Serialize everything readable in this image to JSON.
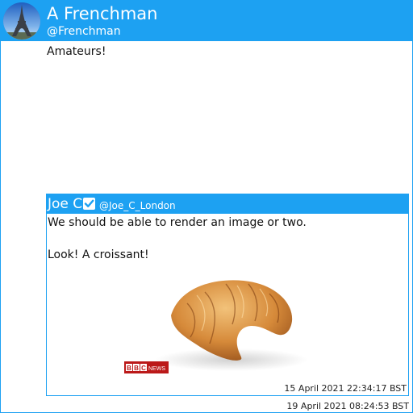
{
  "tweet": {
    "author": {
      "display_name": "A Frenchman",
      "handle": "@Frenchman",
      "avatar_icon": "eiffel-tower-avatar"
    },
    "text": "Amateurs!",
    "timestamp": "19 April 2021 08:24:53 BST"
  },
  "quoted_tweet": {
    "author": {
      "display_name": "Joe C",
      "handle": "@Joe_C_London",
      "verified_icon": "verified-check-icon"
    },
    "lines": [
      "We should be able to render an image or two.",
      "Look! A croissant!"
    ],
    "image": {
      "subject": "croissant",
      "watermark": "BBC NEWS"
    },
    "timestamp": "15 April 2021 22:34:17 BST"
  },
  "colors": {
    "accent": "#1da1f2",
    "text": "#111111",
    "header_text": "#ffffff",
    "bbc_red": "#bb1919"
  }
}
